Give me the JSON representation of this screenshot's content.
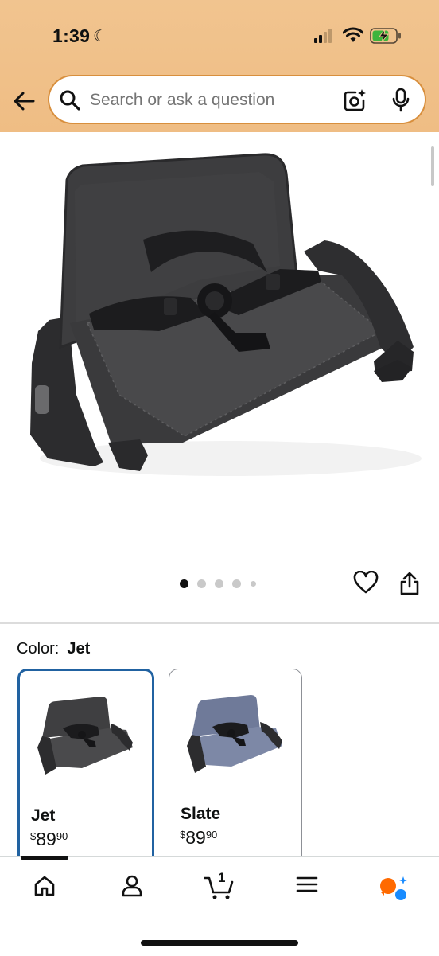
{
  "status_bar": {
    "time": "1:39"
  },
  "search": {
    "placeholder": "Search or ask a question"
  },
  "product_gallery": {
    "image_count": 5,
    "active_index": 0
  },
  "color_selector": {
    "label": "Color:",
    "selected_value": "Jet",
    "options": [
      {
        "name": "Jet",
        "currency": "$",
        "price_whole": "89",
        "price_fraction": "90",
        "selected": true,
        "color": "#3f3f41"
      },
      {
        "name": "Slate",
        "currency": "$",
        "price_whole": "89",
        "price_fraction": "90",
        "selected": false,
        "color": "#6f7a99"
      }
    ]
  },
  "tab_bar": {
    "active": "home",
    "cart_count": "1",
    "items": [
      "home-icon",
      "account-icon",
      "cart-icon",
      "menu-icon",
      "rufus-icon"
    ]
  },
  "colors": {
    "header": "#f1c48f",
    "selected_border": "#2162a1",
    "rufus_orange": "#ff6a00",
    "rufus_blue": "#1a8cff"
  }
}
